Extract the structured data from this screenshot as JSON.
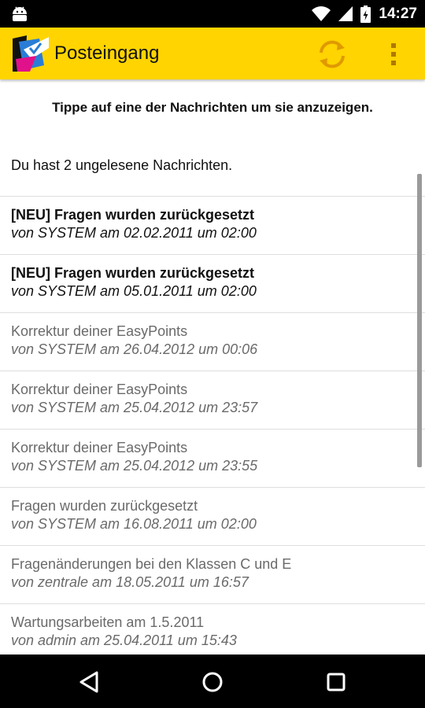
{
  "status_bar": {
    "time": "14:27",
    "icons": [
      "android-icon",
      "wifi-icon",
      "signal-icon",
      "battery-icon"
    ]
  },
  "app_bar": {
    "title": "Posteingang",
    "accent_color": "#ffd400",
    "actions": [
      "refresh-icon",
      "overflow-menu-icon"
    ]
  },
  "inbox": {
    "hint": "Tippe auf eine der Nachrichten um sie anzuzeigen.",
    "unread_count_text": "Du hast 2 ungelesene Nachrichten.",
    "messages": [
      {
        "subject": "[NEU] Fragen wurden zurückgesetzt",
        "meta": "von SYSTEM am 02.02.2011 um 02:00",
        "unread": true
      },
      {
        "subject": "[NEU] Fragen wurden zurückgesetzt",
        "meta": "von SYSTEM am 05.01.2011 um 02:00",
        "unread": true
      },
      {
        "subject": "Korrektur deiner EasyPoints",
        "meta": "von SYSTEM am 26.04.2012 um 00:06",
        "unread": false
      },
      {
        "subject": "Korrektur deiner EasyPoints",
        "meta": "von SYSTEM am 25.04.2012 um 23:57",
        "unread": false
      },
      {
        "subject": "Korrektur deiner EasyPoints",
        "meta": "von SYSTEM am 25.04.2012 um 23:55",
        "unread": false
      },
      {
        "subject": "Fragen wurden zurückgesetzt",
        "meta": "von SYSTEM am 16.08.2011 um 02:00",
        "unread": false
      },
      {
        "subject": "Fragenänderungen bei den Klassen C und E",
        "meta": "von zentrale am 18.05.2011 um 16:57",
        "unread": false
      },
      {
        "subject": "Wartungsarbeiten am 1.5.2011",
        "meta": "von admin am 25.04.2011 um 15:43",
        "unread": false
      }
    ]
  },
  "nav_bar": {
    "buttons": [
      "back-icon",
      "home-icon",
      "recents-icon"
    ]
  }
}
